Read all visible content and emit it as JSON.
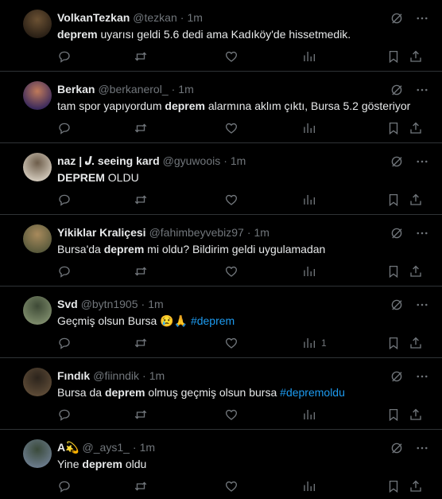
{
  "tweets": [
    {
      "name": "VolkanTezkan",
      "handle": "@tezkan",
      "dot": "·",
      "time": "1m",
      "segments": [
        {
          "t": "deprem",
          "s": "bold"
        },
        {
          "t": " uyarısı geldi 5.6 dedi ama Kadıköy'de hissetmedik.",
          "s": ""
        }
      ],
      "views": "",
      "avatar_colors": [
        "#2a2016",
        "#6b5133"
      ]
    },
    {
      "name": "Berkan",
      "handle": "@berkanerol_",
      "dot": "·",
      "time": "1m",
      "segments": [
        {
          "t": "tam spor yapıyordum ",
          "s": ""
        },
        {
          "t": "deprem",
          "s": "bold"
        },
        {
          "t": " alarmına aklım çıktı, Bursa 5.2 gösteriyor",
          "s": ""
        }
      ],
      "views": "",
      "avatar_colors": [
        "#3b2a5c",
        "#c07a5a"
      ]
    },
    {
      "name": "naz | 𝑱. seeing kard",
      "handle": "@gyuwoois",
      "dot": "·",
      "time": "1m",
      "segments": [
        {
          "t": "DEPREM",
          "s": "bold"
        },
        {
          "t": " OLDU",
          "s": ""
        }
      ],
      "views": "",
      "avatar_colors": [
        "#cfc6b8",
        "#6d5d4a"
      ]
    },
    {
      "name": "Yikiklar Kraliçesi",
      "handle": "@fahimbeyvebiz97",
      "dot": "·",
      "time": "1m",
      "segments": [
        {
          "t": "Bursa'da ",
          "s": ""
        },
        {
          "t": "deprem",
          "s": "bold"
        },
        {
          "t": " mi oldu? Bildirim geldi uygulamadan",
          "s": ""
        }
      ],
      "views": "",
      "avatar_colors": [
        "#5a5a3c",
        "#a88a5c"
      ]
    },
    {
      "name": "Svd",
      "handle": "@bytn1905",
      "dot": "·",
      "time": "1m",
      "segments": [
        {
          "t": "Geçmiş olsun Bursa ",
          "s": ""
        },
        {
          "t": "😢🙏",
          "s": ""
        },
        {
          "t": " ",
          "s": ""
        },
        {
          "t": "#deprem",
          "s": "tag"
        }
      ],
      "views": "1",
      "avatar_colors": [
        "#7c8a6a",
        "#3e4a36"
      ]
    },
    {
      "name": "Fındık",
      "handle": "@fiinndik",
      "dot": "·",
      "time": "1m",
      "segments": [
        {
          "t": "Bursa da ",
          "s": ""
        },
        {
          "t": "deprem",
          "s": "bold"
        },
        {
          "t": " olmuş geçmiş olsun bursa ",
          "s": ""
        },
        {
          "t": "#depremoldu",
          "s": "tag"
        }
      ],
      "views": "",
      "avatar_colors": [
        "#5c4a36",
        "#2c241c"
      ]
    },
    {
      "name": "A💫",
      "handle": "@_ays1_",
      "dot": "·",
      "time": "1m",
      "segments": [
        {
          "t": "Yine ",
          "s": ""
        },
        {
          "t": "deprem",
          "s": "bold"
        },
        {
          "t": " oldu",
          "s": ""
        }
      ],
      "views": "",
      "avatar_colors": [
        "#6a7a8a",
        "#3a4a3a"
      ]
    }
  ],
  "colors": {
    "background": "#000000",
    "text": "#e7e9ea",
    "muted": "#71767b",
    "border": "#2f3336",
    "link": "#1d9bf0"
  }
}
